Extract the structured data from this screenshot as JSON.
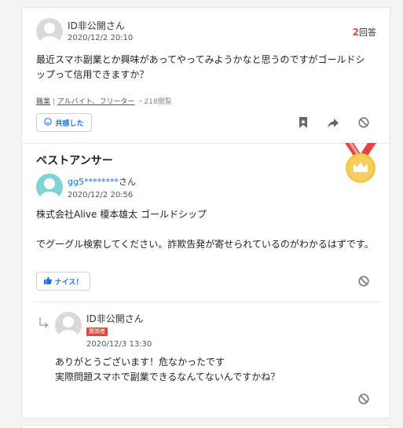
{
  "question": {
    "user": "ID非公開さん",
    "date": "2020/12/2 20:10",
    "answer_count": "2",
    "answer_suffix": "回答",
    "text": "最近スマホ副業とか興味があってやってみようかなと思うのですがゴールドシップって信用できますか？",
    "category1": "職業",
    "separator": "|",
    "category2": "アルバイト、フリーター",
    "views": "・218閲覧",
    "empathy_label": "共感した"
  },
  "best_answer": {
    "heading": "ベストアンサー",
    "user": "gg5********",
    "user_suffix": "さん",
    "date": "2020/12/2 20:56",
    "text": "株式会社Alive 榎本雄太 ゴールドシップ\n\nでグーグル検索してください。詐欺告発が寄せられているのがわかるはずです。",
    "nice_label": "ナイス！"
  },
  "reply": {
    "user": "ID非公開さん",
    "badge": "質問者",
    "date": "2020/12/3 13:30",
    "text": "ありがとうございます！危なかったです\n実際問題スマホで副業できるなんてないんですかね？"
  },
  "colors": {
    "accent_red": "#e2473e",
    "link_blue": "#1e6fd9",
    "medal_gold": "#f2c544",
    "best_avatar": "#7ed3d6"
  }
}
